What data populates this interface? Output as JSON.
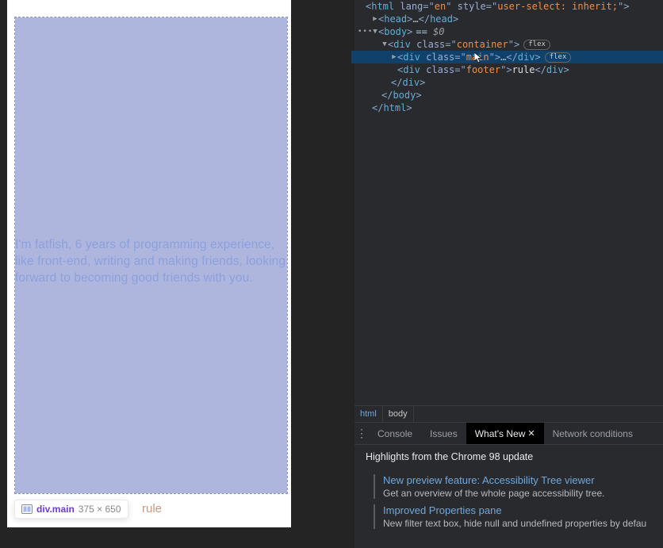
{
  "preview": {
    "body_text": "I'm fatfish, 6 years of programming experience, like front-end, writing and making friends, looking forward to becoming good friends with you.",
    "footer_text": "rule"
  },
  "tooltip": {
    "selector": "div.main",
    "dimensions": "375 × 650"
  },
  "dom_tree": {
    "line0": {
      "tag": "html",
      "attr_lang_n": "lang",
      "attr_lang_v": "en",
      "attr_style_n": "style",
      "attr_style_v": "user-select: inherit;"
    },
    "line1": {
      "tag": "head"
    },
    "line2": {
      "tag": "body",
      "eq": "== ",
      "suffix": "$0"
    },
    "line3": {
      "tag": "div",
      "class_n": "class",
      "class_v": "container",
      "pill": "flex"
    },
    "line4": {
      "tag": "div",
      "class_n": "class",
      "class_v": "main",
      "pill": "flex"
    },
    "line5": {
      "tag": "div",
      "class_n": "class",
      "class_v": "footer",
      "content": "rule"
    },
    "line6": {
      "close": "div"
    },
    "line7": {
      "close": "body"
    },
    "line8": {
      "close": "html"
    }
  },
  "breadcrumb": {
    "b0": "html",
    "b1": "body"
  },
  "drawer": {
    "console": "Console",
    "issues": "Issues",
    "whatsnew": "What's New",
    "netcond": "Network conditions"
  },
  "whatsnew": {
    "header": "Highlights from the Chrome 98 update",
    "item0_t": "New preview feature: Accessibility Tree viewer",
    "item0_d": "Get an overview of the whole page accessibility tree.",
    "item1_t": "Improved Properties pane",
    "item1_d": "New filter text box, hide null and undefined properties by defau"
  }
}
